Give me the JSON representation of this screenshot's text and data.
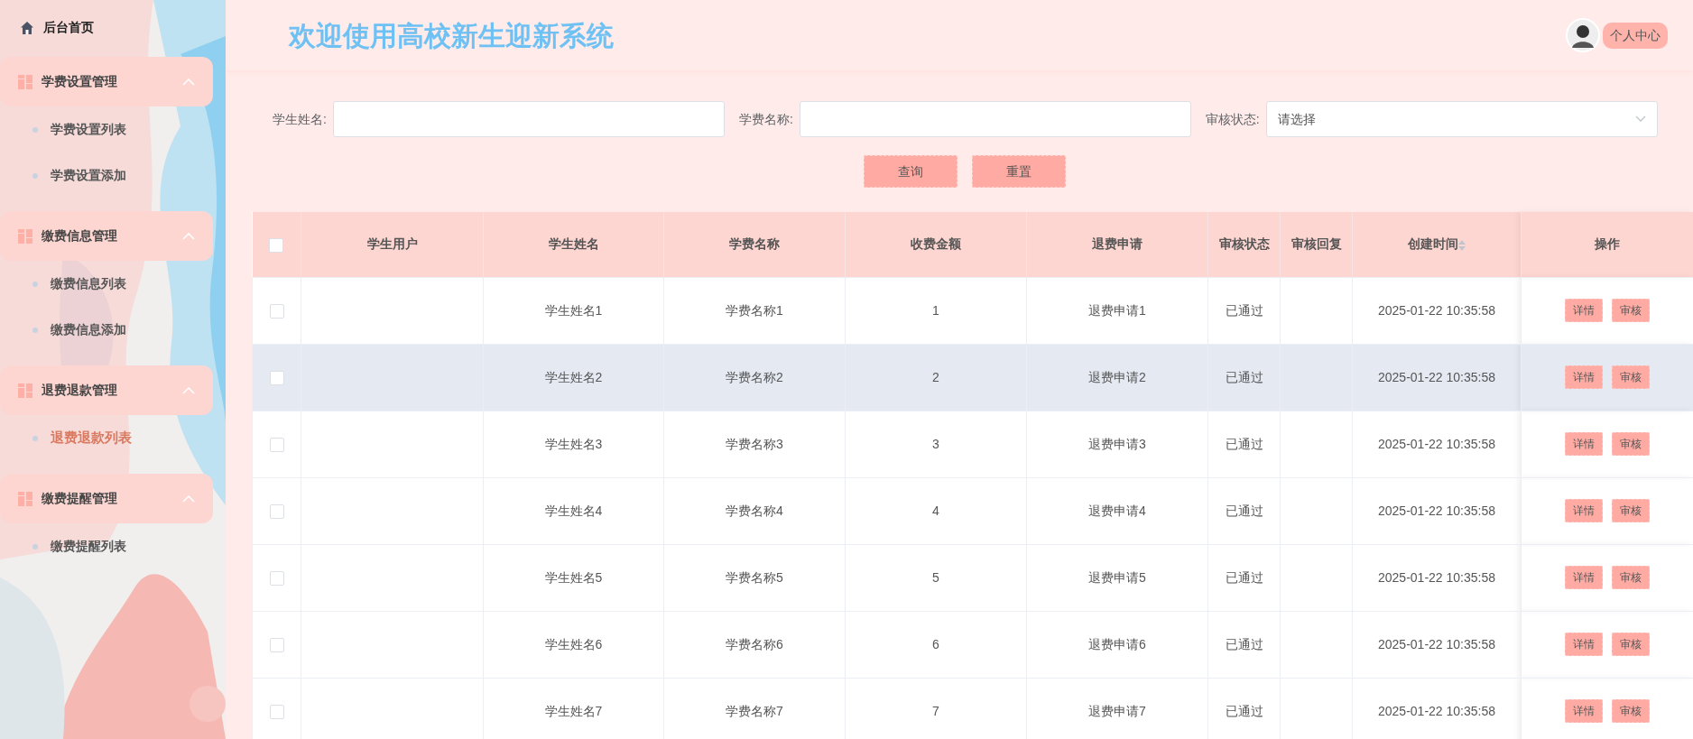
{
  "sidebar": {
    "home": {
      "label": "后台首页"
    },
    "groups": [
      {
        "label": "学费设置管理",
        "expanded": true,
        "items": [
          {
            "label": "学费设置列表",
            "selected": false
          },
          {
            "label": "学费设置添加",
            "selected": false
          }
        ]
      },
      {
        "label": "缴费信息管理",
        "expanded": true,
        "items": [
          {
            "label": "缴费信息列表",
            "selected": false
          },
          {
            "label": "缴费信息添加",
            "selected": false
          }
        ]
      },
      {
        "label": "退费退款管理",
        "expanded": true,
        "items": [
          {
            "label": "退费退款列表",
            "selected": true
          }
        ]
      },
      {
        "label": "缴费提醒管理",
        "expanded": true,
        "items": [
          {
            "label": "缴费提醒列表",
            "selected": false
          }
        ]
      }
    ]
  },
  "header": {
    "title": "欢迎使用高校新生迎新系统",
    "user_button": "个人中心"
  },
  "search": {
    "fields": [
      {
        "kind": "text",
        "label": "学生姓名:"
      },
      {
        "kind": "text",
        "label": "学费名称:"
      },
      {
        "kind": "select",
        "label": "审核状态:",
        "placeholder": "请选择"
      }
    ],
    "buttons": [
      "查询",
      "重置"
    ]
  },
  "table": {
    "all_checked": false,
    "columns": [
      "学生用户",
      "学生姓名",
      "学费名称",
      "收费金额",
      "退费申请",
      "审核状态",
      "审核回复",
      "创建时间",
      "操作"
    ],
    "rows": [
      {
        "checked": false,
        "highlighted": false,
        "cells": [
          "",
          "学生姓名1",
          "学费名称1",
          "1",
          "退费申请1",
          "已通过",
          "",
          "2025-01-22 10:35:58"
        ],
        "actions": [
          "详情",
          "审核"
        ]
      },
      {
        "checked": false,
        "highlighted": true,
        "cells": [
          "",
          "学生姓名2",
          "学费名称2",
          "2",
          "退费申请2",
          "已通过",
          "",
          "2025-01-22 10:35:58"
        ],
        "actions": [
          "详情",
          "审核"
        ]
      },
      {
        "checked": false,
        "highlighted": false,
        "cells": [
          "",
          "学生姓名3",
          "学费名称3",
          "3",
          "退费申请3",
          "已通过",
          "",
          "2025-01-22 10:35:58"
        ],
        "actions": [
          "详情",
          "审核"
        ]
      },
      {
        "checked": false,
        "highlighted": false,
        "cells": [
          "",
          "学生姓名4",
          "学费名称4",
          "4",
          "退费申请4",
          "已通过",
          "",
          "2025-01-22 10:35:58"
        ],
        "actions": [
          "详情",
          "审核"
        ]
      },
      {
        "checked": false,
        "highlighted": false,
        "cells": [
          "",
          "学生姓名5",
          "学费名称5",
          "5",
          "退费申请5",
          "已通过",
          "",
          "2025-01-22 10:35:58"
        ],
        "actions": [
          "详情",
          "审核"
        ]
      },
      {
        "checked": false,
        "highlighted": false,
        "cells": [
          "",
          "学生姓名6",
          "学费名称6",
          "6",
          "退费申请6",
          "已通过",
          "",
          "2025-01-22 10:35:58"
        ],
        "actions": [
          "详情",
          "审核"
        ]
      },
      {
        "checked": false,
        "highlighted": false,
        "cells": [
          "",
          "学生姓名7",
          "学费名称7",
          "7",
          "退费申请7",
          "已通过",
          "",
          "2025-01-22 10:35:58"
        ],
        "actions": [
          "详情",
          "审核"
        ]
      }
    ]
  }
}
